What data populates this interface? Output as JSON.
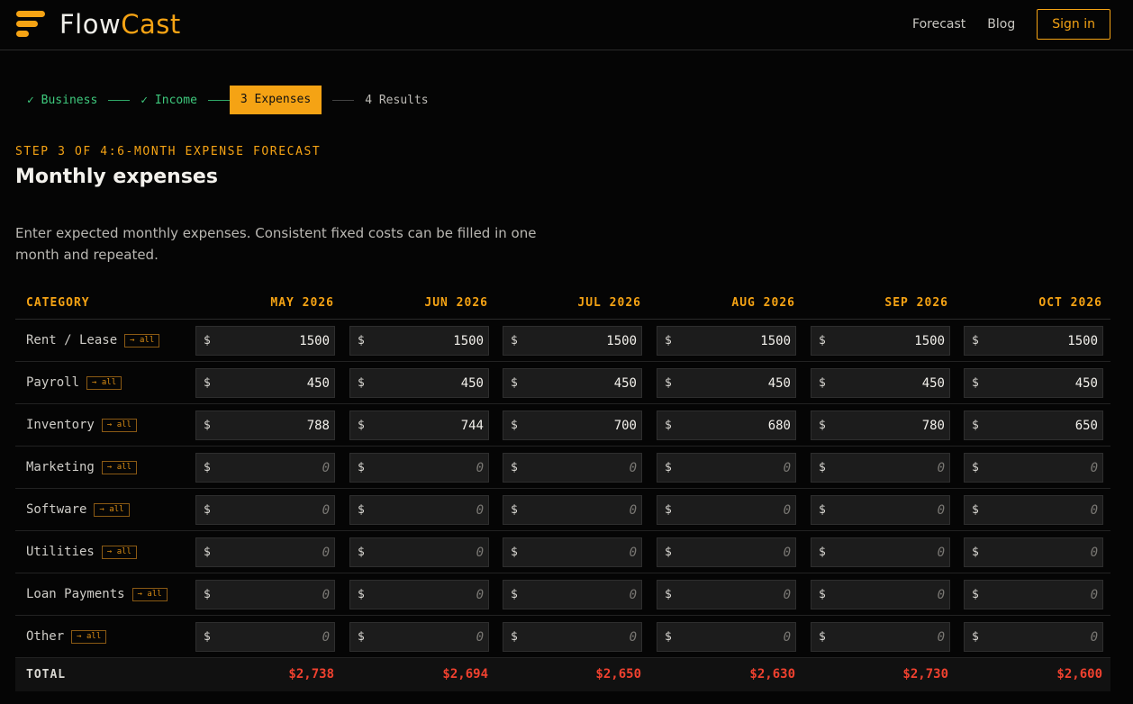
{
  "brand": {
    "name_part1": "Flow",
    "name_part2": "Cast",
    "accent": "#f5a314"
  },
  "nav": {
    "links": [
      "Forecast",
      "Blog"
    ],
    "signin": "Sign in"
  },
  "stepper": {
    "steps": [
      {
        "label": "✓ Business",
        "state": "done"
      },
      {
        "label": "✓ Income",
        "state": "done"
      },
      {
        "label": "3 Expenses",
        "state": "active"
      },
      {
        "label": "4 Results",
        "state": "todo"
      }
    ]
  },
  "eyebrow": "STEP 3 OF 4:6-MONTH EXPENSE FORECAST",
  "title": "Monthly expenses",
  "description": "Enter expected monthly expenses. Consistent fixed costs can be filled in one month and repeated.",
  "table": {
    "category_header": "CATEGORY",
    "months": [
      "MAY 2026",
      "JUN 2026",
      "JUL 2026",
      "AUG 2026",
      "SEP 2026",
      "OCT 2026"
    ],
    "fill_all_label": "→ all",
    "currency_symbol": "$",
    "placeholder": "0",
    "rows": [
      {
        "category": "Rent / Lease",
        "values": [
          "1500",
          "1500",
          "1500",
          "1500",
          "1500",
          "1500"
        ]
      },
      {
        "category": "Payroll",
        "values": [
          "450",
          "450",
          "450",
          "450",
          "450",
          "450"
        ]
      },
      {
        "category": "Inventory",
        "values": [
          "788",
          "744",
          "700",
          "680",
          "780",
          "650"
        ]
      },
      {
        "category": "Marketing",
        "values": [
          "",
          "",
          "",
          "",
          "",
          ""
        ]
      },
      {
        "category": "Software",
        "values": [
          "",
          "",
          "",
          "",
          "",
          ""
        ]
      },
      {
        "category": "Utilities",
        "values": [
          "",
          "",
          "",
          "",
          "",
          ""
        ]
      },
      {
        "category": "Loan Payments",
        "values": [
          "",
          "",
          "",
          "",
          "",
          ""
        ]
      },
      {
        "category": "Other",
        "values": [
          "",
          "",
          "",
          "",
          "",
          ""
        ]
      }
    ],
    "total_label": "TOTAL",
    "totals": [
      "$2,738",
      "$2,694",
      "$2,650",
      "$2,630",
      "$2,730",
      "$2,600"
    ]
  }
}
